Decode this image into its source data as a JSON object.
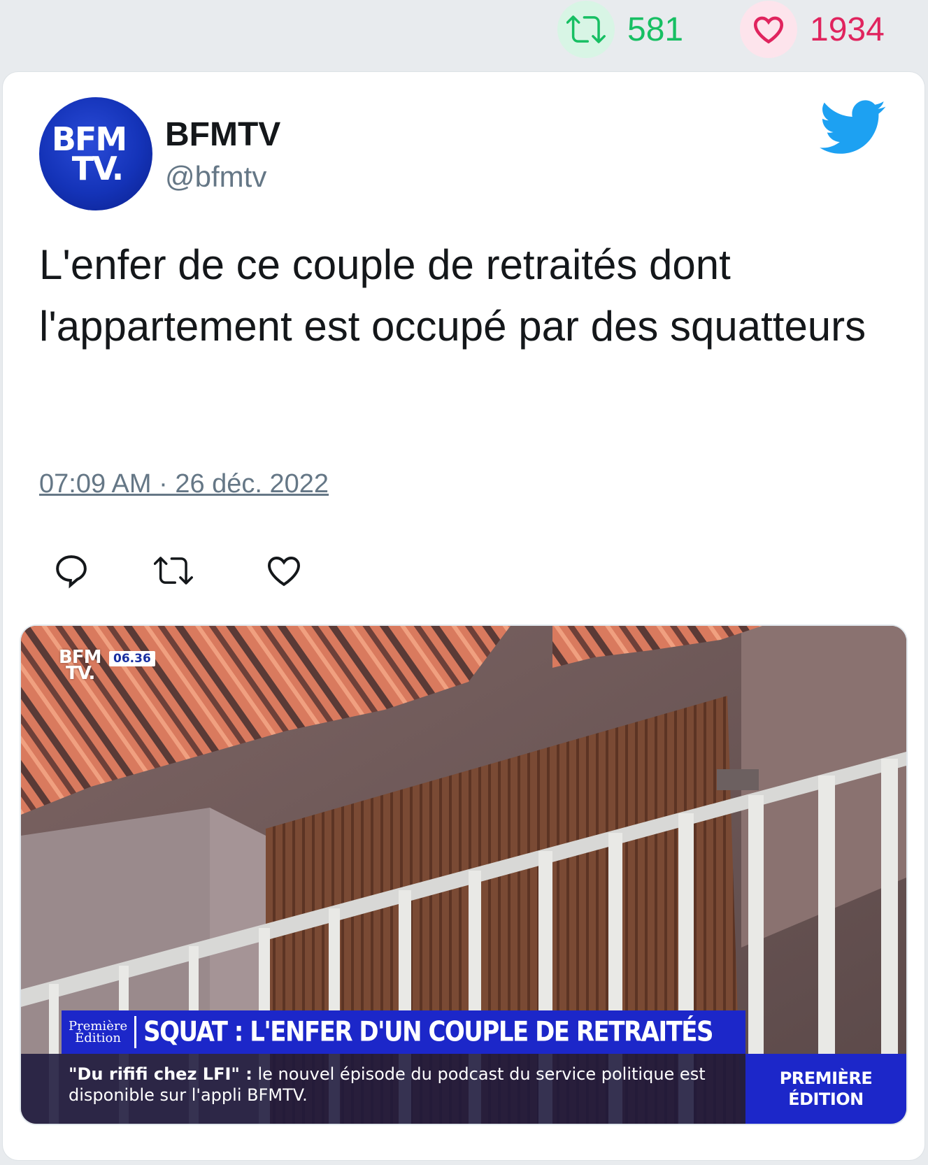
{
  "stats": {
    "retweets": "581",
    "likes": "1934"
  },
  "tweet": {
    "author_name": "BFMTV",
    "author_handle": "@bfmtv",
    "avatar_text_line1": "BFM",
    "avatar_text_line2": "TV.",
    "text": "L'enfer de ce couple de retraités dont l'appartement est occupé par des squatteurs",
    "timestamp": "07:09 AM · 26 déc. 2022"
  },
  "media": {
    "logo_line1": "BFM",
    "logo_line2": "TV.",
    "clock": "06.36",
    "program_line1": "Première",
    "program_line2": "Édition",
    "headline": "SQUAT : L'ENFER D'UN COUPLE DE RETRAITÉS",
    "ticker_bold": "\"Du rififi chez LFI\" :",
    "ticker_text": " le nouvel épisode du podcast du service politique est disponible sur l'appli BFMTV.",
    "tag_line1": "PREMIÈRE",
    "tag_line2": "ÉDITION"
  },
  "colors": {
    "retweet_green": "#17bf63",
    "like_red": "#e0245e",
    "twitter_blue": "#1da1f2",
    "bfm_blue": "#1c27c9"
  },
  "icons": [
    "retweet-icon",
    "heart-icon",
    "twitter-bird-icon",
    "reply-icon"
  ]
}
